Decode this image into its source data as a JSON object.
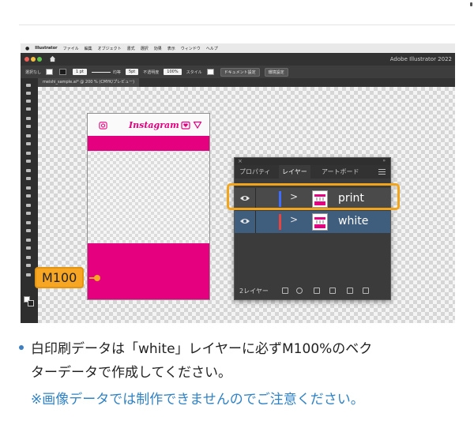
{
  "macbar": {
    "apple": "",
    "app_name": "Illustrator",
    "menu": [
      "ファイル",
      "編集",
      "オブジェクト",
      "書式",
      "選択",
      "効果",
      "表示",
      "ウィンドウ",
      "ヘルプ"
    ]
  },
  "window": {
    "title": "Adobe Illustrator 2022"
  },
  "control_bar": {
    "selection": "選択なし",
    "stroke_weight": "1 pt",
    "stroke_profile": "均等",
    "brush": "5pt",
    "opacity_label": "不透明度",
    "opacity_value": "100%",
    "style_label": "スタイル",
    "doc_settings_button": "ドキュメント設定",
    "prefs_button": "環境設定"
  },
  "document_tab": {
    "label": "meishi_sample.ai* @ 200 % (CMYK/プレビュー)"
  },
  "artboard": {
    "logo_text": "Instagram"
  },
  "callout": {
    "label": "M100"
  },
  "layers_panel": {
    "tabs": [
      "プロパティ",
      "レイヤー",
      "アートボード"
    ],
    "active_tab": "レイヤー",
    "layers": [
      {
        "name": "print",
        "color": "#3d6cff"
      },
      {
        "name": "white",
        "color": "#e8433e"
      }
    ],
    "footer_label": "2レイヤー"
  },
  "caption": {
    "line1": "白印刷データは「white」レイヤーに必ずM100%のベク",
    "line2": "ターデータで作成してください。",
    "note": "※画像データでは制作できませんのでご注意ください。"
  },
  "colors": {
    "magenta": "#e5007f",
    "highlight": "#f2a51b",
    "note_blue": "#2f82c5"
  }
}
